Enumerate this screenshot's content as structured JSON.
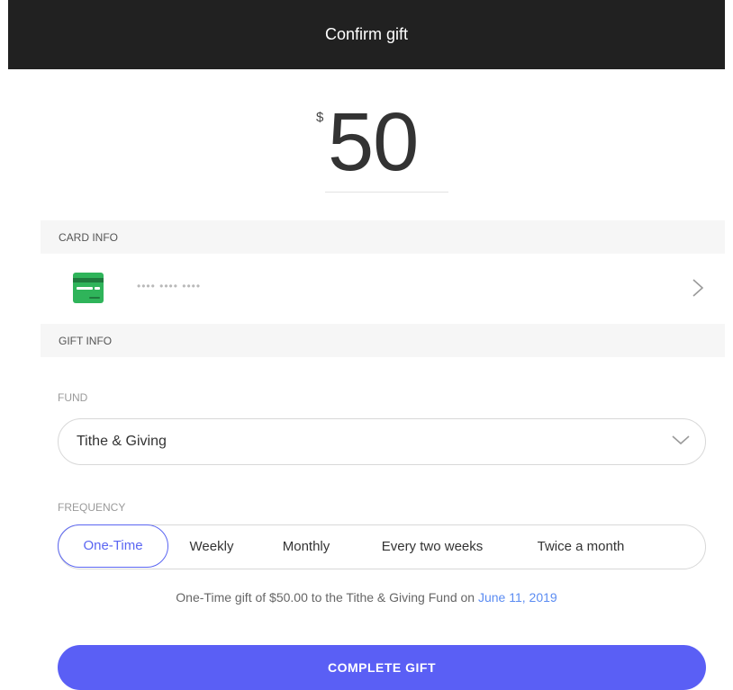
{
  "header": {
    "title": "Confirm gift"
  },
  "amount": {
    "currency": "$",
    "value": "50"
  },
  "card_info": {
    "section_label": "CARD INFO",
    "card_mask": "•••• •••• ••••",
    "card_icon": "credit-card-icon"
  },
  "gift_info": {
    "section_label": "GIFT INFO",
    "fund": {
      "label": "FUND",
      "selected": "Tithe & Giving"
    },
    "frequency": {
      "label": "FREQUENCY",
      "options": [
        "One-Time",
        "Weekly",
        "Monthly",
        "Every two weeks",
        "Twice a month"
      ],
      "selected": "One-Time"
    }
  },
  "summary": {
    "text": "One-Time gift of $50.00 to the Tithe & Giving Fund on ",
    "date": "June 11, 2019"
  },
  "actions": {
    "complete_label": "COMPLETE GIFT"
  },
  "colors": {
    "header_bg": "#212121",
    "accent": "#5a5ff5",
    "card_green": "#2fb45a",
    "date_link": "#5b8cf2"
  }
}
